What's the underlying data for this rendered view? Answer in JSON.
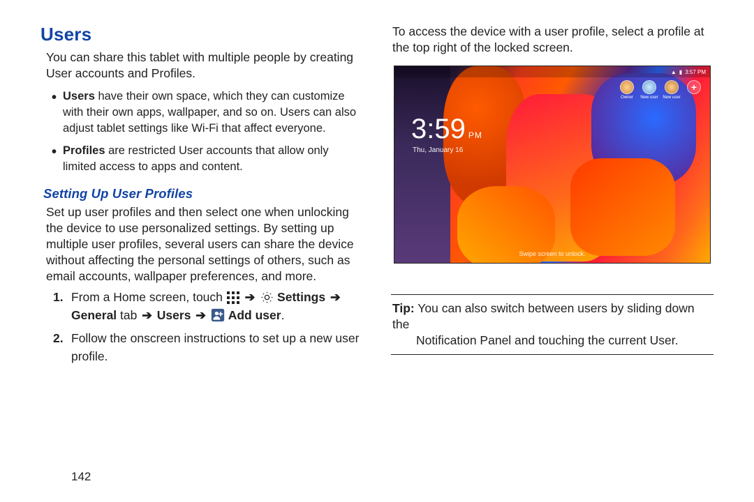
{
  "heading": "Users",
  "intro": "You can share this tablet with multiple people by creating User accounts and Profiles.",
  "bullets": [
    {
      "bold": "Users",
      "text": " have their own space, which they can customize with their own apps, wallpaper, and so on. Users can also adjust tablet settings like Wi-Fi that affect everyone."
    },
    {
      "bold": "Profiles",
      "text": " are restricted User accounts that allow only limited access to apps and content."
    }
  ],
  "section_heading": "Setting Up User Profiles",
  "section_body": "Set up user profiles and then select one when unlocking the device to use personalized settings. By setting up multiple user profiles, several users can share the device without affecting the personal settings of others, such as email accounts, wallpaper preferences, and more.",
  "step1": {
    "prefix": "From a Home screen, touch ",
    "settings": " Settings ",
    "general_tab": "General",
    "tab_word": " tab ",
    "users": " Users ",
    "add_user": " Add user",
    "period": "."
  },
  "step2": "Follow the onscreen instructions to set up a new user profile.",
  "right_intro": "To access the device with a user profile, select a profile at the top right of the locked screen.",
  "tip_label": "Tip:",
  "tip_line1": " You can also switch between users by sliding down the",
  "tip_line2": "Notification Panel and touching the current User.",
  "lockscreen": {
    "time": "3:59",
    "ampm": "PM",
    "date": "Thu, January 16",
    "swipe": "Swipe screen to unlock.",
    "status_time": "3:57 PM",
    "profiles": [
      "Owner",
      "New user",
      "New user",
      "+"
    ]
  },
  "page_number": "142"
}
